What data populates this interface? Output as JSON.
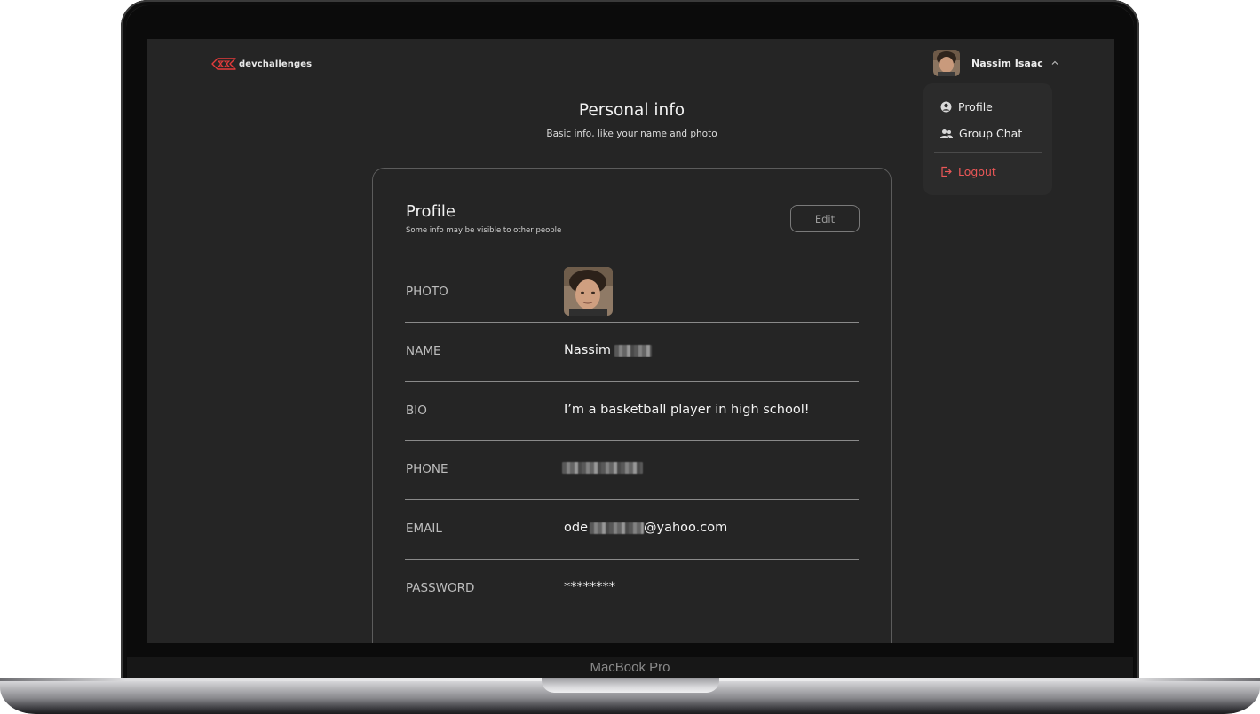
{
  "device": {
    "label": "MacBook Pro"
  },
  "header": {
    "logo_text": "devchallenges",
    "user_name": "Nassim Isaac"
  },
  "dropdown": {
    "items": [
      {
        "label": "Profile",
        "icon": "user-circle-icon"
      },
      {
        "label": "Group Chat",
        "icon": "group-icon"
      },
      {
        "label": "Logout",
        "icon": "logout-icon",
        "color": "#eb5757"
      }
    ]
  },
  "page": {
    "title": "Personal info",
    "subtitle": "Basic info, like your name and photo"
  },
  "profile_card": {
    "title": "Profile",
    "subtitle": "Some info may be visible to other people",
    "edit_label": "Edit",
    "rows": {
      "photo": {
        "label": "PHOTO"
      },
      "name": {
        "label": "NAME",
        "value": "Nassim"
      },
      "bio": {
        "label": "BIO",
        "value": "I’m a basketball player in high school!"
      },
      "phone": {
        "label": "PHONE",
        "value": ""
      },
      "email": {
        "label": "EMAIL",
        "value_prefix": "ode",
        "value_suffix": "@yahoo.com"
      },
      "password": {
        "label": "PASSWORD",
        "value": "********"
      }
    }
  },
  "colors": {
    "background": "#252525",
    "card_border": "#5c5c5c",
    "text": "#f2f2f2",
    "danger": "#eb5757"
  }
}
